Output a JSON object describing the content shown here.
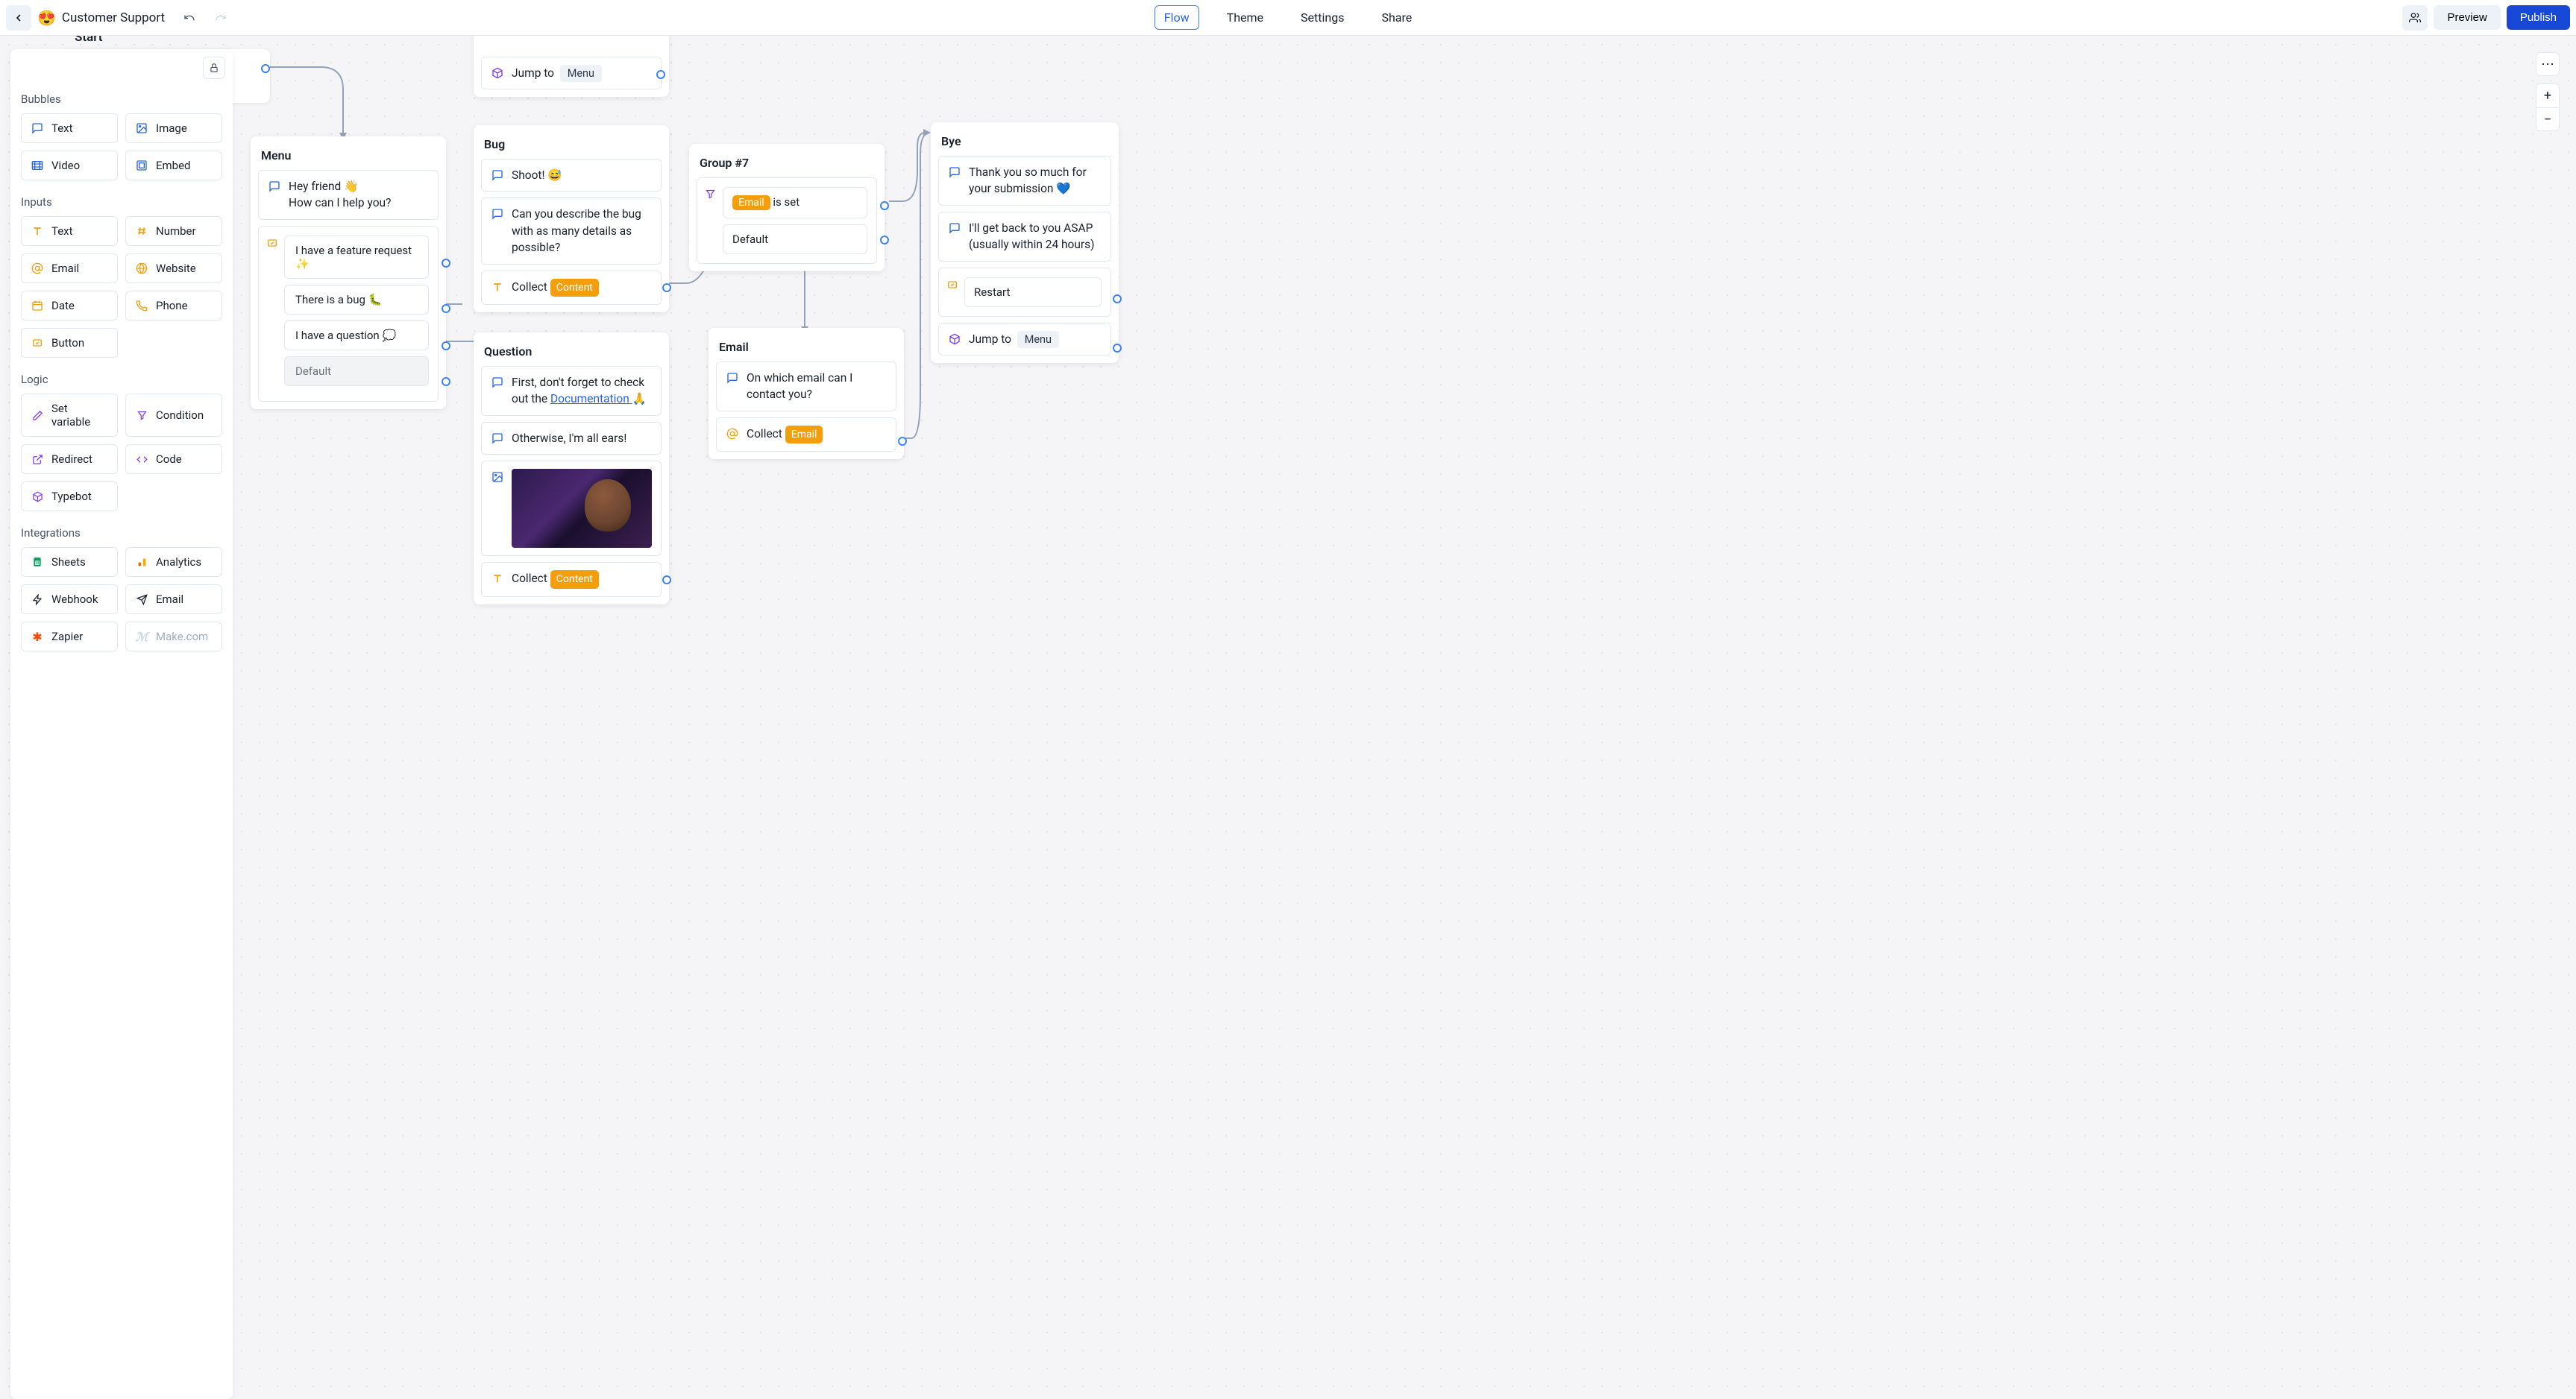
{
  "header": {
    "emoji": "😍",
    "title": "Customer Support",
    "tabs": [
      "Flow",
      "Theme",
      "Settings",
      "Share"
    ],
    "active_tab": 0,
    "preview_label": "Preview",
    "publish_label": "Publish"
  },
  "palette": {
    "sections": {
      "bubbles": {
        "label": "Bubbles",
        "items": [
          "Text",
          "Image",
          "Video",
          "Embed"
        ]
      },
      "inputs": {
        "label": "Inputs",
        "items": [
          "Text",
          "Number",
          "Email",
          "Website",
          "Date",
          "Phone",
          "Button"
        ]
      },
      "logic": {
        "label": "Logic",
        "items": [
          "Set variable",
          "Condition",
          "Redirect",
          "Code",
          "Typebot"
        ]
      },
      "integrations": {
        "label": "Integrations",
        "items": [
          "Sheets",
          "Analytics",
          "Webhook",
          "Email",
          "Zapier",
          "Make.com"
        ]
      }
    }
  },
  "colors": {
    "icon_blue": "#2563eb",
    "icon_orange": "#f59e0b",
    "icon_purple": "#7c3aed",
    "icon_green": "#059669",
    "icon_gray": "#64748b"
  },
  "flow": {
    "start_label": "Start",
    "nodes": {
      "jump_top": {
        "label": "Jump to",
        "target": "Menu"
      },
      "menu": {
        "title": "Menu",
        "greeting_l1": "Hey friend 👋",
        "greeting_l2": "How can I help you?",
        "options": [
          "I have a feature request ✨",
          "There is a bug 🐛",
          "I have a question 💭"
        ],
        "default_label": "Default"
      },
      "bug": {
        "title": "Bug",
        "line1": "Shoot! 😅",
        "line2": "Can you describe the bug with as many details as possible?",
        "collect_label": "Collect",
        "collect_var": "Content"
      },
      "question": {
        "title": "Question",
        "line1_pre": "First, don't forget to check out the ",
        "line1_link": "Documentation ",
        "line1_post": "🙏",
        "line2": "Otherwise, I'm all ears!",
        "collect_label": "Collect",
        "collect_var": "Content"
      },
      "group7": {
        "title": "Group #7",
        "cond_var": "Email",
        "cond_text": " is set",
        "default_label": "Default"
      },
      "email": {
        "title": "Email",
        "line1": "On which email can I contact you?",
        "collect_label": "Collect",
        "collect_var": "Email"
      },
      "bye": {
        "title": "Bye",
        "line1": "Thank you so much for your submission 💙",
        "line2": "I'll get back to you ASAP (usually within 24 hours)",
        "restart_label": "Restart",
        "jump_label": "Jump to",
        "jump_target": "Menu"
      }
    }
  }
}
